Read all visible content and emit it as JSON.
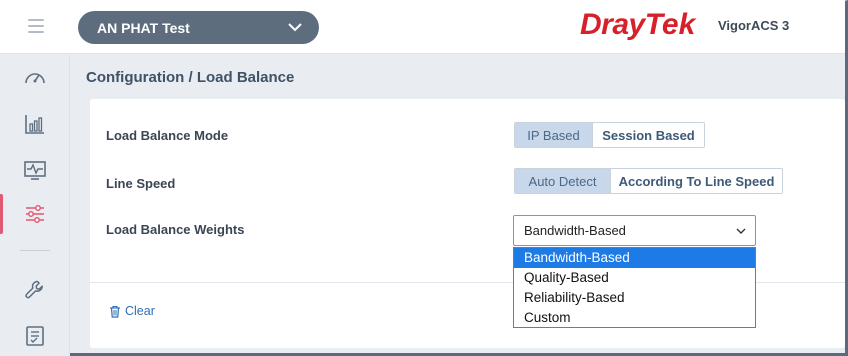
{
  "header": {
    "device": "AN PHAT Test",
    "logo_dray": "Dray",
    "logo_tek": "Tek",
    "product": "VigorACS 3"
  },
  "sidebar": {
    "items": [
      {
        "icon": "speedometer-icon"
      },
      {
        "icon": "bar-chart-icon"
      },
      {
        "icon": "monitor-pulse-icon"
      },
      {
        "icon": "sliders-icon",
        "active": true
      },
      {
        "icon": "wrench-icon"
      },
      {
        "icon": "checklist-icon"
      }
    ]
  },
  "breadcrumb": "Configuration / Load Balance",
  "form": {
    "mode": {
      "label": "Load Balance Mode",
      "options": [
        "IP Based",
        "Session Based"
      ],
      "selected": "IP Based"
    },
    "speed": {
      "label": "Line Speed",
      "options": [
        "Auto Detect",
        "According To Line Speed"
      ],
      "selected": "Auto Detect"
    },
    "weights": {
      "label": "Load Balance Weights",
      "value": "Bandwidth-Based",
      "options": [
        "Bandwidth-Based",
        "Quality-Based",
        "Reliability-Based",
        "Custom"
      ],
      "highlighted": "Bandwidth-Based"
    }
  },
  "actions": {
    "clear": "Clear"
  },
  "colors": {
    "accent": "#d8202a",
    "active_indicator": "#e15a73",
    "highlight": "#1e7be6",
    "selected_segment": "#c8d8ea"
  }
}
